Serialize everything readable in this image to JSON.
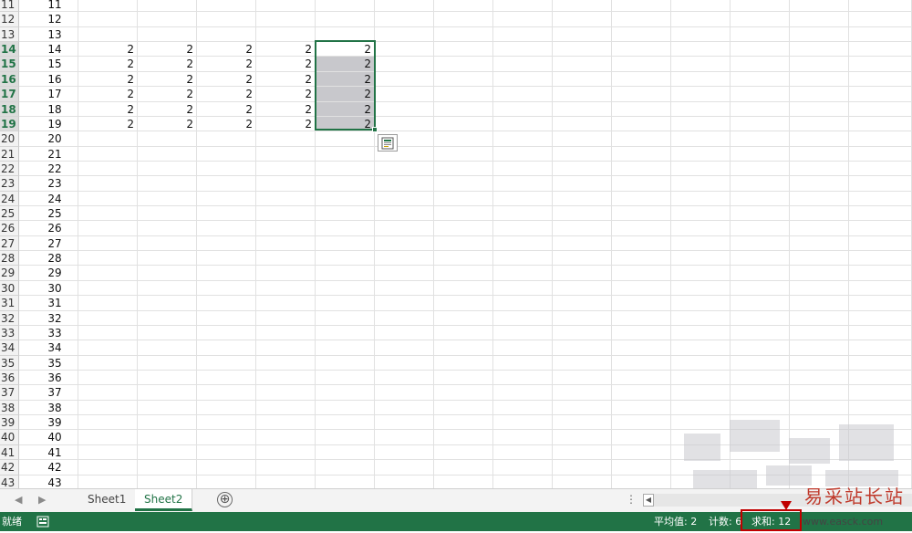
{
  "sheet": {
    "rows": [
      {
        "num": "11",
        "a": "11",
        "values": []
      },
      {
        "num": "12",
        "a": "12",
        "values": []
      },
      {
        "num": "13",
        "a": "13",
        "values": []
      },
      {
        "num": "14",
        "a": "14",
        "values": [
          "2",
          "2",
          "2",
          "2",
          "2"
        ]
      },
      {
        "num": "15",
        "a": "15",
        "values": [
          "2",
          "2",
          "2",
          "2",
          "2"
        ]
      },
      {
        "num": "16",
        "a": "16",
        "values": [
          "2",
          "2",
          "2",
          "2",
          "2"
        ]
      },
      {
        "num": "17",
        "a": "17",
        "values": [
          "2",
          "2",
          "2",
          "2",
          "2"
        ]
      },
      {
        "num": "18",
        "a": "18",
        "values": [
          "2",
          "2",
          "2",
          "2",
          "2"
        ]
      },
      {
        "num": "19",
        "a": "19",
        "values": [
          "2",
          "2",
          "2",
          "2",
          "2"
        ]
      },
      {
        "num": "20",
        "a": "20",
        "values": []
      },
      {
        "num": "21",
        "a": "21",
        "values": []
      },
      {
        "num": "22",
        "a": "22",
        "values": []
      },
      {
        "num": "23",
        "a": "23",
        "values": []
      },
      {
        "num": "24",
        "a": "24",
        "values": []
      },
      {
        "num": "25",
        "a": "25",
        "values": []
      },
      {
        "num": "26",
        "a": "26",
        "values": []
      },
      {
        "num": "27",
        "a": "27",
        "values": []
      },
      {
        "num": "28",
        "a": "28",
        "values": []
      },
      {
        "num": "29",
        "a": "29",
        "values": []
      },
      {
        "num": "30",
        "a": "30",
        "values": []
      },
      {
        "num": "31",
        "a": "31",
        "values": []
      },
      {
        "num": "32",
        "a": "32",
        "values": []
      },
      {
        "num": "33",
        "a": "33",
        "values": []
      },
      {
        "num": "34",
        "a": "34",
        "values": []
      },
      {
        "num": "35",
        "a": "35",
        "values": []
      },
      {
        "num": "36",
        "a": "36",
        "values": []
      },
      {
        "num": "37",
        "a": "37",
        "values": []
      },
      {
        "num": "38",
        "a": "38",
        "values": []
      },
      {
        "num": "39",
        "a": "39",
        "values": []
      },
      {
        "num": "40",
        "a": "40",
        "values": []
      },
      {
        "num": "41",
        "a": "41",
        "values": []
      },
      {
        "num": "42",
        "a": "42",
        "values": []
      },
      {
        "num": "43",
        "a": "43",
        "values": []
      }
    ],
    "selected_rows": [
      "14",
      "15",
      "16",
      "17",
      "18",
      "19"
    ]
  },
  "tabs": {
    "items": [
      "Sheet1",
      "Sheet2"
    ],
    "active": "Sheet2",
    "add_label": "⊕",
    "more_label": "⋮"
  },
  "status": {
    "ready": "就绪",
    "average": "平均值: 2",
    "count": "计数: 6",
    "sum": "求和: 12"
  },
  "watermark": {
    "text": "易采站长站",
    "url": "www.easck.com"
  },
  "colors": {
    "accent": "#217346",
    "highlight": "#c00000",
    "selection_fill": "#c8c8cc"
  }
}
